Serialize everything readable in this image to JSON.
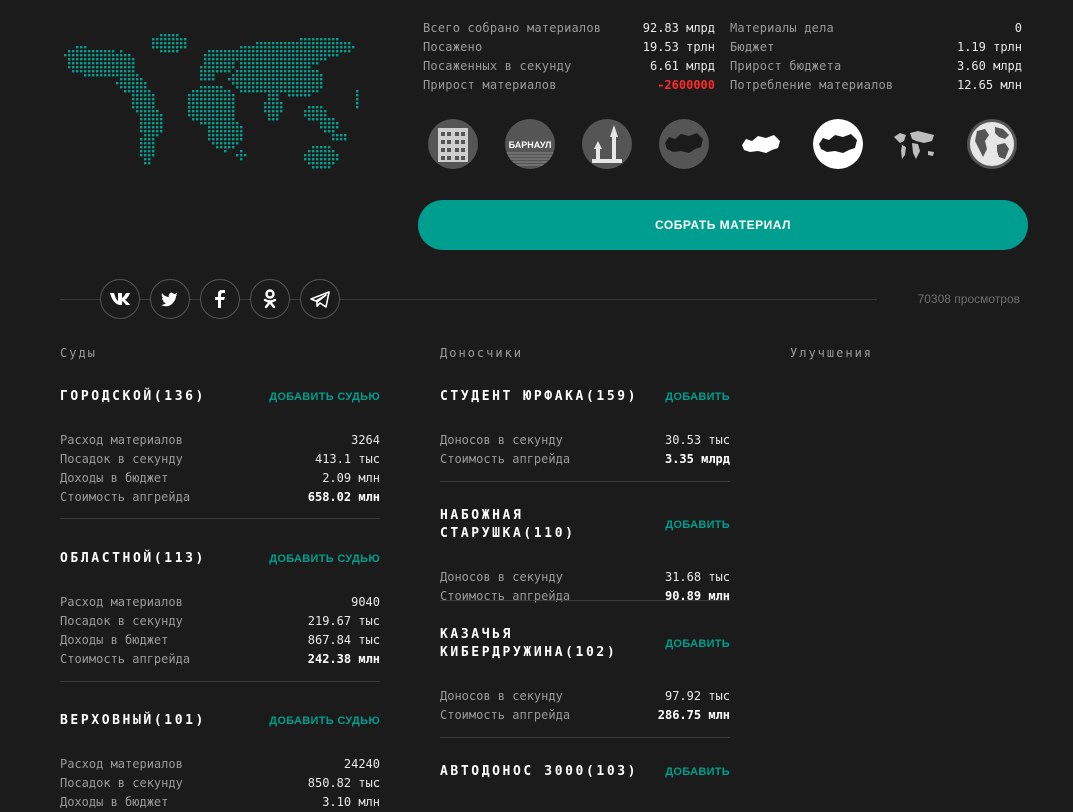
{
  "stats_left": [
    {
      "label": "Всего собрано материалов",
      "value": "92.83 млрд",
      "negative": false
    },
    {
      "label": "Посажено",
      "value": "19.53 трлн",
      "negative": false
    },
    {
      "label": "Посаженных в секунду",
      "value": "6.61 млрд",
      "negative": false
    },
    {
      "label": "Прирост материалов",
      "value": "-2600000",
      "negative": true
    }
  ],
  "stats_right": [
    {
      "label": "Материалы дела",
      "value": "0"
    },
    {
      "label": "Бюджет",
      "value": "1.19 трлн"
    },
    {
      "label": "Прирост бюджета",
      "value": "3.60 млрд"
    },
    {
      "label": "Потребление материалов",
      "value": "12.65 млн"
    }
  ],
  "levels": [
    {
      "icon": "building-icon",
      "label": ""
    },
    {
      "icon": "barnaul-icon",
      "label": "БАРНАУЛ"
    },
    {
      "icon": "moscow-kremlin-icon",
      "label": ""
    },
    {
      "icon": "russia-map-dark-icon",
      "label": ""
    },
    {
      "icon": "russia-map-outline-icon",
      "label": ""
    },
    {
      "icon": "russia-map-white-icon",
      "label": ""
    },
    {
      "icon": "world-map-icon",
      "label": ""
    },
    {
      "icon": "globe-icon",
      "label": ""
    }
  ],
  "collect_button": "СОБРАТЬ МАТЕРИАЛ",
  "social": [
    {
      "icon": "vk-icon"
    },
    {
      "icon": "twitter-icon"
    },
    {
      "icon": "facebook-icon"
    },
    {
      "icon": "odnoklassniki-icon"
    },
    {
      "icon": "telegram-icon"
    }
  ],
  "views": "70308 просмотров",
  "sections": {
    "courts": "Суды",
    "informers": "Доносчики",
    "upgrades": "Улучшения"
  },
  "courts": [
    {
      "name": "ГОРОДСКОЙ(136)",
      "add": "ДОБАВИТЬ СУДЬЮ",
      "rows": [
        {
          "label": "Расход материалов",
          "value": "3264",
          "strong": false
        },
        {
          "label": "Посадок в секунду",
          "value": "413.1 тыс",
          "strong": false
        },
        {
          "label": "Доходы в бюджет",
          "value": "2.09 млн",
          "strong": false
        },
        {
          "label": "Стоимость апгрейда",
          "value": "658.02 млн",
          "strong": true
        }
      ]
    },
    {
      "name": "ОБЛАСТНОЙ(113)",
      "add": "ДОБАВИТЬ СУДЬЮ",
      "rows": [
        {
          "label": "Расход материалов",
          "value": "9040",
          "strong": false
        },
        {
          "label": "Посадок в секунду",
          "value": "219.67 тыс",
          "strong": false
        },
        {
          "label": "Доходы в бюджет",
          "value": "867.84 тыс",
          "strong": false
        },
        {
          "label": "Стоимость апгрейда",
          "value": "242.38 млн",
          "strong": true
        }
      ]
    },
    {
      "name": "ВЕРХОВНЫЙ(101)",
      "add": "ДОБАВИТЬ СУДЬЮ",
      "rows": [
        {
          "label": "Расход материалов",
          "value": "24240",
          "strong": false
        },
        {
          "label": "Посадок в секунду",
          "value": "850.82 тыс",
          "strong": false
        },
        {
          "label": "Доходы в бюджет",
          "value": "3.10 млн",
          "strong": false
        }
      ]
    }
  ],
  "informers": [
    {
      "name": "СТУДЕНТ ЮРФАКА(159)",
      "add": "ДОБАВИТЬ",
      "rows": [
        {
          "label": "Доносов в секунду",
          "value": "30.53 тыс",
          "strong": false
        },
        {
          "label": "Стоимость апгрейда",
          "value": "3.35 млрд",
          "strong": true
        }
      ]
    },
    {
      "name": "НАБОЖНАЯ СТАРУШКА(110)",
      "add": "ДОБАВИТЬ",
      "rows": [
        {
          "label": "Доносов в секунду",
          "value": "31.68 тыс",
          "strong": false
        },
        {
          "label": "Стоимость апгрейда",
          "value": "90.89 млн",
          "strong": true
        }
      ]
    },
    {
      "name": "КАЗАЧЬЯ КИБЕРДРУЖИНА(102)",
      "add": "ДОБАВИТЬ",
      "rows": [
        {
          "label": "Доносов в секунду",
          "value": "97.92 тыс",
          "strong": false
        },
        {
          "label": "Стоимость апгрейда",
          "value": "286.75 млн",
          "strong": true
        }
      ]
    },
    {
      "name": "АВТОДОНОС 3000(103)",
      "add": "ДОБАВИТЬ",
      "rows": []
    }
  ],
  "colors": {
    "accent": "#009e8e",
    "negative": "#ff2a2a",
    "background": "#1b1b1b"
  }
}
